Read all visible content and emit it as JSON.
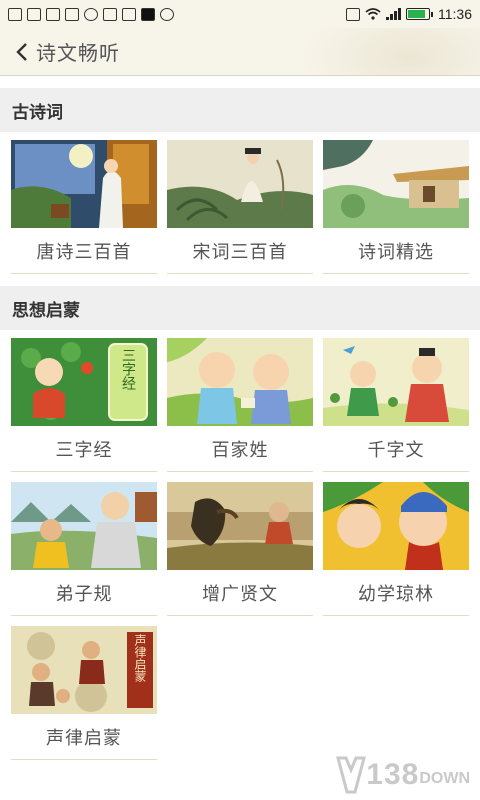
{
  "status_bar": {
    "time": "11:36"
  },
  "header": {
    "title": "诗文畅听"
  },
  "sections": [
    {
      "title": "古诗词",
      "items": [
        {
          "label": "唐诗三百首"
        },
        {
          "label": "宋词三百首"
        },
        {
          "label": "诗词精选"
        }
      ]
    },
    {
      "title": "思想启蒙",
      "items": [
        {
          "label": "三字经",
          "badge": "三字经"
        },
        {
          "label": "百家姓"
        },
        {
          "label": "千字文"
        },
        {
          "label": "弟子规"
        },
        {
          "label": "增广贤文"
        },
        {
          "label": "幼学琼林"
        },
        {
          "label": "声律启蒙",
          "badge": "声律启蒙"
        }
      ]
    }
  ],
  "watermark": {
    "number": "138",
    "word": "DOWN"
  }
}
